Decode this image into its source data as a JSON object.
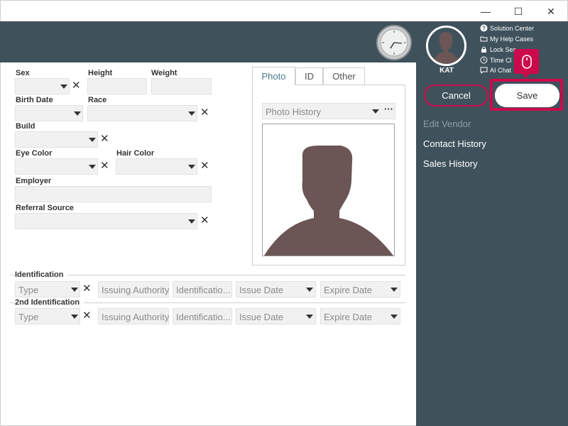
{
  "window": {
    "minimize": "—",
    "maximize": "☐",
    "close": "✕"
  },
  "user": {
    "name": "KAT"
  },
  "top_links": [
    "Solution Center",
    "My Help Cases",
    "Lock Ses",
    "Time Cl",
    "AI Chat"
  ],
  "actions": {
    "cancel": "Cancel",
    "save": "Save"
  },
  "side_menu": {
    "edit_vendor": "Edit Vendor",
    "contact_history": "Contact History",
    "sales_history": "Sales History"
  },
  "form": {
    "sex": "Sex",
    "height": "Height",
    "weight": "Weight",
    "birth_date": "Birth Date",
    "race": "Race",
    "build": "Build",
    "eye_color": "Eye Color",
    "hair_color": "Hair Color",
    "employer": "Employer",
    "referral_source": "Referral Source"
  },
  "photo": {
    "tabs": [
      "Photo",
      "ID",
      "Other"
    ],
    "history_placeholder": "Photo History",
    "more": "···"
  },
  "identification": {
    "title": "Identification",
    "type": "Type",
    "issuing_authority": "Issuing Authority",
    "identification_number": "Identificatio...",
    "issue_date": "Issue Date",
    "expire_date": "Expire Date"
  },
  "identification2": {
    "title": "2nd Identification",
    "type": "Type",
    "issuing_authority": "Issuing Authority",
    "identification_number": "Identificatio...",
    "issue_date": "Issue Date",
    "expire_date": "Expire Date"
  },
  "colors": {
    "header": "#3f525c",
    "accent": "#cc0a4b",
    "avatar_bg": "#6b5655"
  }
}
